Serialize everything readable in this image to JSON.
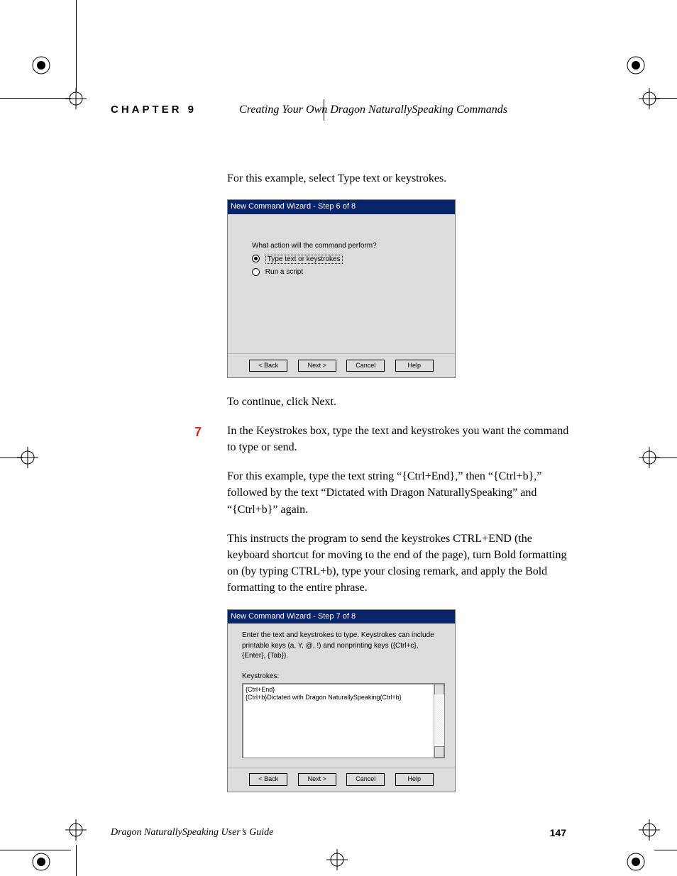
{
  "header": {
    "chapter": "CHAPTER 9",
    "title": "Creating Your Own Dragon NaturallySpeaking Commands"
  },
  "intro1": "For this example, select Type text or keystrokes.",
  "dialog1": {
    "title": "New Command Wizard - Step 6 of 8",
    "prompt": "What action will the command perform?",
    "option1": "Type text or keystrokes",
    "option2": "Run a script",
    "back": "< Back",
    "next": "Next >",
    "cancel": "Cancel",
    "help": "Help"
  },
  "intro2": "To continue, click Next.",
  "step_num": "7",
  "step_text": "In the Keystrokes box, type the text and keystrokes you want the command to type or send.",
  "para2": "For this example, type the text string “{Ctrl+End},” then “{Ctrl+b},” followed by the text “Dictated with Dragon NaturallySpeaking” and “{Ctrl+b}” again.",
  "para3a": "This instructs the program to send the keystrokes ",
  "para3_sc1": "CTRL+END",
  "para3b": " (the keyboard shortcut for moving to the end of the page), turn Bold formatting on (by typing ",
  "para3_sc2": "CTRL",
  "para3c": "+b), type your closing remark, and apply the Bold formatting to the entire phrase.",
  "dialog2": {
    "title": "New Command Wizard - Step 7 of 8",
    "instr": "Enter the text and keystrokes to type.  Keystrokes can include printable keys (a, Y, @, !) and nonprinting keys ({Ctrl+c}, {Enter}, {Tab}).",
    "label": "Keystrokes:",
    "line1": "{Ctrl+End}",
    "line2": "{Ctrl+b}Dictated with Dragon NaturallySpeaking{Ctrl+b}",
    "back": "< Back",
    "next": "Next >",
    "cancel": "Cancel",
    "help": "Help"
  },
  "footer": {
    "title": "Dragon NaturallySpeaking User’s Guide",
    "page": "147"
  }
}
